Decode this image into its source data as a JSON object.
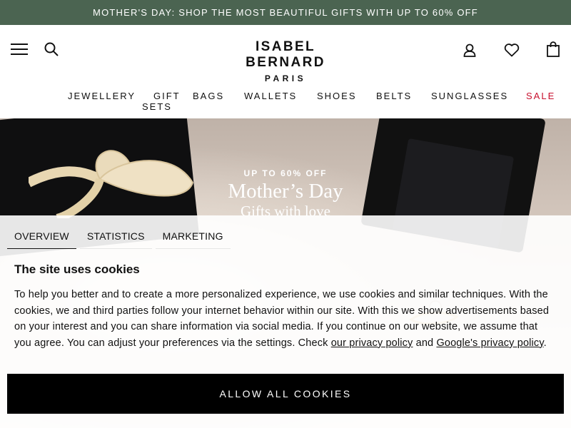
{
  "promo": {
    "text": "MOTHER'S DAY: SHOP THE MOST BEAUTIFUL GIFTS WITH UP TO 60% OFF",
    "bg_color": "#4b6451"
  },
  "header": {
    "logo_main": "ISABEL BERNARD",
    "logo_sub": "PARIS",
    "icons": [
      "menu-icon",
      "search-icon",
      "account-icon",
      "heart-icon",
      "shopping-bag-icon"
    ]
  },
  "nav": {
    "items": [
      {
        "label": "JEWELLERY"
      },
      {
        "label": "GIFT"
      },
      {
        "label": "SETS"
      },
      {
        "label": "BAGS"
      },
      {
        "label": "WALLETS"
      },
      {
        "label": "SHOES"
      },
      {
        "label": "BELTS"
      },
      {
        "label": "SUNGLASSES"
      },
      {
        "label": "SALE"
      }
    ],
    "sale_color": "#c8102e"
  },
  "hero": {
    "kicker": "UP TO 60% OFF",
    "title": "Mother’s Day",
    "subtitle": "Gifts with love"
  },
  "cookies": {
    "tabs": [
      {
        "label": "OVERVIEW",
        "active": true
      },
      {
        "label": "STATISTICS",
        "active": false
      },
      {
        "label": "MARKETING",
        "active": false
      }
    ],
    "title": "The site uses cookies",
    "body": "To help you better and to create a more personalized experience, we use cookies and similar techniques. With the cookies, we and third parties follow your internet behavior within our site. With this we show advertisements based on your interest and you can share information via social media. If you continue on our website, we assume that you agree. You can adjust your preferences via the settings. Check ",
    "privacy_link": "our privacy policy",
    "and_text": " and ",
    "google_link": "Google's privacy policy",
    "end_text": ".",
    "allow_button": "ALLOW ALL COOKIES"
  }
}
